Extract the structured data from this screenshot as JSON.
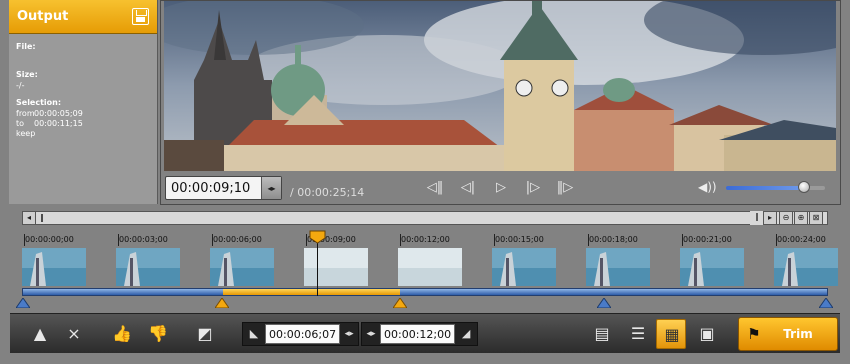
{
  "output": {
    "title": "Output",
    "file_label": "File:",
    "file_value": "",
    "size_label": "Size:",
    "size_value": "-/-",
    "selection_label": "Selection:",
    "from_label": "from",
    "from_value": "00:00:05;09",
    "to_label": "to",
    "to_value": "00:00:11;15",
    "mode_value": "keep"
  },
  "player": {
    "current_time": "00:00:09;10",
    "duration": "/ 00:00:25;14",
    "volume_percent": 78,
    "controls": [
      "skip-to-start",
      "step-back",
      "play",
      "step-forward",
      "skip-to-end"
    ]
  },
  "timeline": {
    "ruler_labels": [
      "00:00:00;00",
      "00:00:03;00",
      "00:00:06;00",
      "00:00:09;00",
      "00:00:12;00",
      "00:00:15;00",
      "00:00:18;00",
      "00:00:21;00",
      "00:00:24;00"
    ],
    "playhead_time": "00:00:09;10",
    "selection_start": "00:00:06;07",
    "selection_end": "00:00:12;00",
    "colors": {
      "selection": "#f2b21c",
      "track": "#4a7bc8",
      "accent": "#f4a80f"
    }
  },
  "toolbar": {
    "start_time": "00:00:06;07",
    "end_time": "00:00:12;00",
    "trim_label": "Trim"
  }
}
